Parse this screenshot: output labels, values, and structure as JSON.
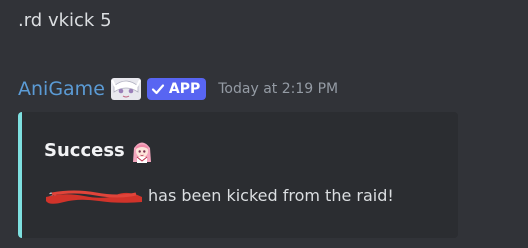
{
  "previous_message": {
    "text": ".rd vkick 5"
  },
  "message": {
    "author": "AniGame",
    "author_color": "#5b9bd5",
    "author_avatar_emoji": "anime-face-emoji",
    "badge": {
      "icon": "check-icon",
      "label": "APP",
      "color": "#5865f2"
    },
    "timestamp": "Today at 2:19 PM",
    "embed": {
      "accent_color": "#7ee0e0",
      "title": "Success",
      "title_emoji": "anime-girl-emoji",
      "description_redacted": "redacted-username",
      "description": "has been kicked from the raid!"
    }
  }
}
